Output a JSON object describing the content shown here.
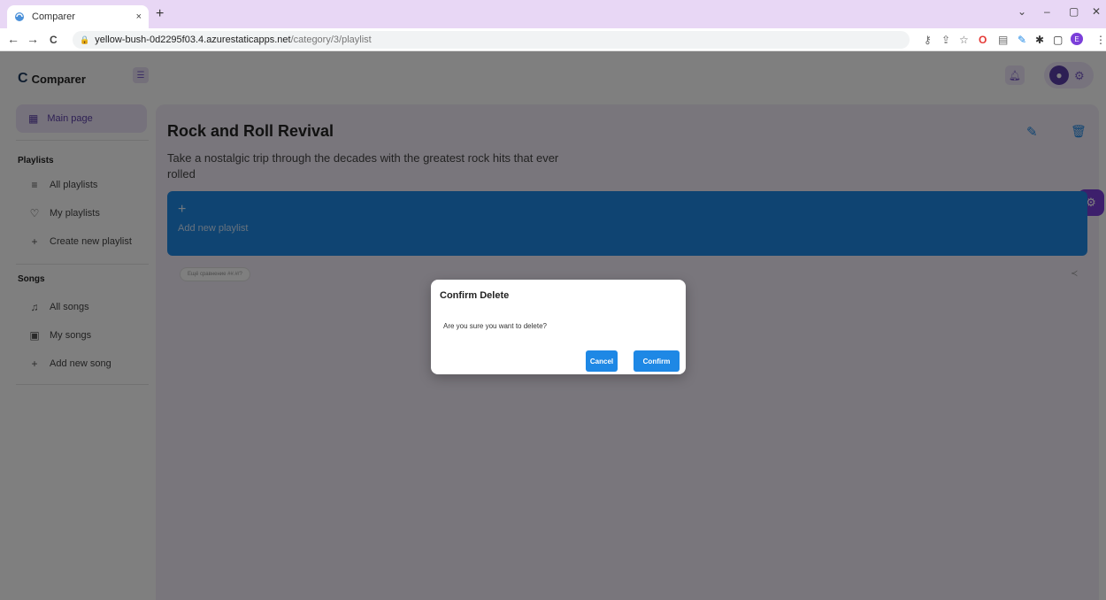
{
  "browser": {
    "tab_title": "Comparer",
    "tab_close": "×",
    "new_tab": "+",
    "back": "←",
    "forward": "→",
    "reload": "C",
    "url_host": "yellow-bush-0d2295f03.4.azurestaticapps.net",
    "url_path": "/category/3/playlist",
    "minimize": "–",
    "maximize": "▢",
    "close": "✕",
    "collapse": "⌄",
    "profile_initial": "E"
  },
  "sidebar": {
    "logo": "Comparer",
    "main_page": "Main page",
    "playlists_title": "Playlists",
    "playlist_items": [
      "All playlists",
      "My playlists",
      "Create new playlist"
    ],
    "songs_title": "Songs",
    "song_items": [
      "All songs",
      "My songs",
      "Add new song"
    ]
  },
  "main": {
    "title": "Rock and Roll Revival",
    "description": "Take a nostalgic trip through the decades with the greatest rock hits that ever rolled",
    "add_plus": "+",
    "add_label": "Add new playlist",
    "chip": "Ещё сравнение ##.#/?"
  },
  "modal": {
    "title": "Confirm Delete",
    "message": "Are you sure you want to delete?",
    "cancel": "Cancel",
    "confirm": "Confirm"
  },
  "colors": {
    "accent": "#1e88e5",
    "purple": "#7b3fd9"
  }
}
